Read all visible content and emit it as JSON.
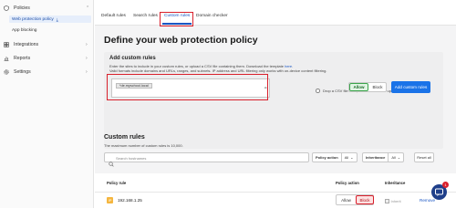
{
  "sidebar": {
    "policies": "Policies",
    "web_protection_policy": "Web protection policy",
    "app_blocking": "App blocking",
    "integrations": "Integrations",
    "reports": "Reports",
    "settings": "Settings"
  },
  "tabs": [
    "Default rules",
    "Search rules",
    "Custom rules",
    "Domain checker"
  ],
  "page_title": "Define your web protection policy",
  "add_rules": {
    "heading": "Add custom rules",
    "desc_1_before": "Enter the sites to include in your custom rules, or upload a CSV file containing them. Download the template ",
    "desc_1_link": "here",
    "desc_1_after": ".",
    "desc_2": "Valid formats include domains and URLs, ranges, and subnets. IP address and URL filtering only works with on-device content filtering.",
    "chip": "*de.myschool.local",
    "drop_before": "Drop a CSV file here, or ",
    "drop_link": "select a file",
    "drop_after": " for upload.",
    "allow": "Allow",
    "block": "Block",
    "add_button": "Add custom rules"
  },
  "custom_rules": {
    "title": "Custom rules",
    "subtitle": "The maximum number of custom rules is 10,000.",
    "search_placeholder": "Search hostnames",
    "policy_action_label": "Policy action",
    "policy_action_value": "All",
    "inheritance_label": "Inheritance",
    "inheritance_value": "All",
    "reset": "Reset all"
  },
  "table": {
    "col_rule": "Policy rule",
    "col_action": "Policy action",
    "col_inheritance": "Inheritance",
    "rows": [
      {
        "icon": "IP",
        "rule": "192.168.1.25",
        "allow": "Allow",
        "block": "Block",
        "inherit": "Inherit",
        "remove": "Remove"
      }
    ]
  },
  "notification_count": "1",
  "colors": {
    "accent": "#1a73e8",
    "highlight_box": "#d9202c",
    "allow_active": "#3aa54b",
    "block_active": "#d9202c"
  }
}
